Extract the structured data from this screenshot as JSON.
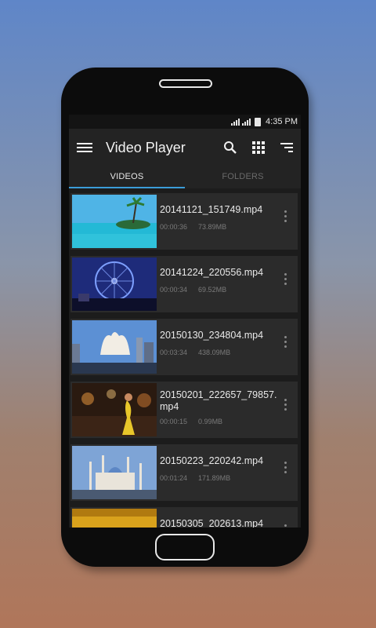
{
  "status": {
    "time": "4:35 PM"
  },
  "toolbar": {
    "title": "Video Player",
    "icons": [
      "menu-icon",
      "search-icon",
      "grid-icon",
      "sort-icon"
    ]
  },
  "tabs": [
    {
      "label": "VIDEOS",
      "active": true
    },
    {
      "label": "FOLDERS",
      "active": false
    }
  ],
  "videos": [
    {
      "name": "20141121_151749.mp4",
      "duration": "00:00:36",
      "size": "73.89MB"
    },
    {
      "name": "20141224_220556.mp4",
      "duration": "00:00:34",
      "size": "69.52MB"
    },
    {
      "name": "20150130_234804.mp4",
      "duration": "00:03:34",
      "size": "438.09MB"
    },
    {
      "name": "20150201_222657_79857.mp4",
      "duration": "00:00:15",
      "size": "0.99MB"
    },
    {
      "name": "20150223_220242.mp4",
      "duration": "00:01:24",
      "size": "171.89MB"
    },
    {
      "name": "20150305_202613.mp4",
      "duration": "",
      "size": ""
    }
  ],
  "colors": {
    "accent": "#3b9cd8",
    "background": "#1c1c1c",
    "card": "#2b2b2b"
  }
}
